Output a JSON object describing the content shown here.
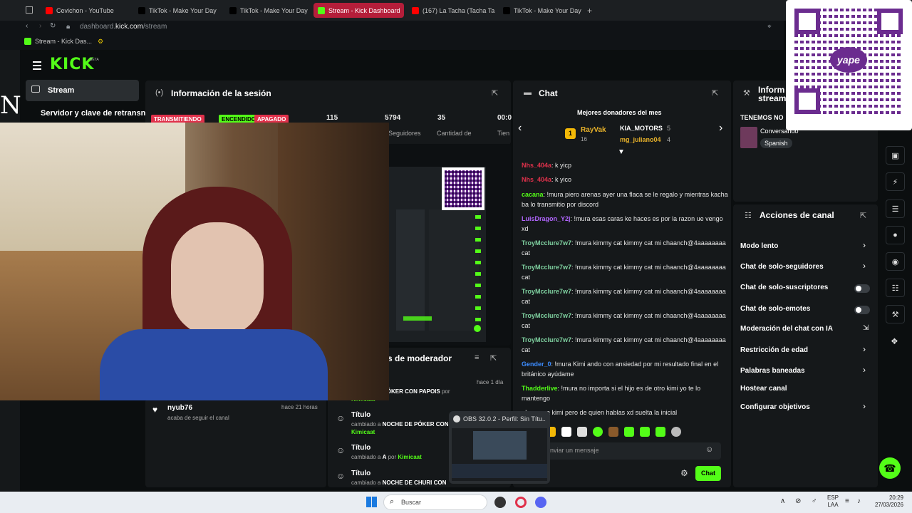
{
  "browser": {
    "tabs": [
      {
        "label": "Cevichon - YouTube",
        "color": "#ff0000"
      },
      {
        "label": "TikTok - Make Your Day",
        "color": "#000000"
      },
      {
        "label": "TikTok - Make Your Day",
        "color": "#000000"
      },
      {
        "label": "Stream - Kick Dashboard",
        "color": "#53fc18",
        "active": true
      },
      {
        "label": "(167) La Tacha (Tacha Ta",
        "color": "#ff0000"
      },
      {
        "label": "TikTok - Make Your Day",
        "color": "#000000"
      }
    ],
    "new_tab": "+",
    "url_domain": "dashboard.",
    "url_host": "kick.com",
    "url_path": "/stream",
    "bookmark": "Stream - Kick Das..."
  },
  "kick": {
    "logo": "KICK",
    "logo_beta": "BETA",
    "nav_stream": "Stream",
    "server_key": "Servidor y clave de retransn",
    "letter": "N"
  },
  "session": {
    "title": "Información de la sesión",
    "badge_transmitting": "TRANSMITIENDO",
    "badge_on": "ENCENDIDO",
    "badge_off": "APAGADO",
    "stat1": "115",
    "stat2": "5794",
    "stat2_label": "Seguidores",
    "stat3": "35",
    "stat3_label": "Cantidad de",
    "stat4": "00:0",
    "stat4_label": "Tien"
  },
  "activity": {
    "moderator_title": "s de moderador",
    "item0_time": "hace 1 día",
    "item0_text": "NOCHE DE PÓKER CON PAPOIS",
    "item0_by": "por",
    "item0_user": "Kimicaat",
    "item1_title": "Título",
    "item1_change": "cambiado a",
    "item1_text": "NOCHE DE PÓKER CON",
    "item1_user": "Kimicaat",
    "item2_title": "Título",
    "item2_change": "cambiado a",
    "item2_text": "A",
    "item2_by": "por",
    "item2_user": "Kimicaat",
    "item3_title": "Título",
    "item3_change": "cambiado a",
    "item3_text": "NOCHE DE CHURI CON"
  },
  "follower": {
    "user": "nyub76",
    "action": "acaba de seguir el canal",
    "time": "hace 21 horas"
  },
  "chat": {
    "title": "Chat",
    "donors_title": "Mejores donadores del mes",
    "donor1_rank": "1",
    "donor1_name": "RayVak",
    "donor1_count": "16",
    "donor2_name": "KIA_MOTORS",
    "donor2_count": "5",
    "donor3_name": "mg_juliano04",
    "donor3_count": "4",
    "messages": [
      {
        "user": "Nhs_404a",
        "color": "#e0314b",
        "text": ": k yicp"
      },
      {
        "user": "Nhs_404a",
        "color": "#e0314b",
        "text": ": k yico"
      },
      {
        "user": "cacana",
        "color": "#53fc18",
        "text": ": !mura piero arenas ayer una flaca se le regalo y mientras kacha ba lo transmitio por discord"
      },
      {
        "user": "LuisDragon_Y2j",
        "color": "#b266ff",
        "text": ": !mura esas caras ke haces es por la razon ue vengo xd"
      },
      {
        "user": "TroyMcclure7w7",
        "color": "#7fd1a0",
        "text": ": !mura kimmy cat kimmy cat mi chaanch@4aaaaaaaa cat"
      },
      {
        "user": "TroyMcclure7w7",
        "color": "#7fd1a0",
        "text": ": !mura kimmy cat kimmy cat mi chaanch@4aaaaaaaa cat"
      },
      {
        "user": "TroyMcclure7w7",
        "color": "#7fd1a0",
        "text": ": !mura kimmy cat kimmy cat mi chaanch@4aaaaaaaa cat"
      },
      {
        "user": "TroyMcclure7w7",
        "color": "#7fd1a0",
        "text": ": !mura kimmy cat kimmy cat mi chaanch@4aaaaaaaa cat"
      },
      {
        "user": "TroyMcclure7w7",
        "color": "#7fd1a0",
        "text": ": !mura kimmy cat kimmy cat mi chaanch@4aaaaaaaa cat"
      },
      {
        "user": "Gender_0",
        "color": "#3c8cff",
        "text": ": !mura Kimi ando con ansiedad por mi resultado final en el británico ayúdame"
      },
      {
        "user": "Thadderlive",
        "color": "#53fc18",
        "text": ": !mura no importa si el hijo es de otro kimi yo te lo mantengo"
      },
      {
        "user": "",
        "color": "#ffffff",
        "text": ": !mura ya kimi pero de quien hablas xd suelta la inicial"
      }
    ],
    "input_placeholder": "nviar un mensaje",
    "send_label": "Chat"
  },
  "right": {
    "info_title": "Inform",
    "info_title2": "stream",
    "tenemos": "TENEMOS NO",
    "category": "Conversando",
    "language": "Spanish",
    "actions_title": "Acciones de canal",
    "actions": [
      {
        "label": "Modo lento",
        "control": "chevron"
      },
      {
        "label": "Chat de solo-seguidores",
        "control": "chevron"
      },
      {
        "label": "Chat de solo-suscriptores",
        "control": "toggle"
      },
      {
        "label": "Chat de solo-emotes",
        "control": "toggle"
      },
      {
        "label": "Moderación del chat con IA",
        "control": "link"
      },
      {
        "label": "Restricción de edad",
        "control": "chevron"
      },
      {
        "label": "Palabras baneadas",
        "control": "chevron"
      },
      {
        "label": "Hostear canal",
        "control": "none"
      },
      {
        "label": "Configurar objetivos",
        "control": "chevron"
      }
    ]
  },
  "qr": {
    "brand": "yape"
  },
  "obs": {
    "title": "OBS 32.0.2 - Perfil: Sin Títu..."
  },
  "taskbar": {
    "search": "Buscar",
    "lang": "ESP",
    "lang2": "LAA",
    "time": "20:29",
    "date": "27/03/2026"
  }
}
